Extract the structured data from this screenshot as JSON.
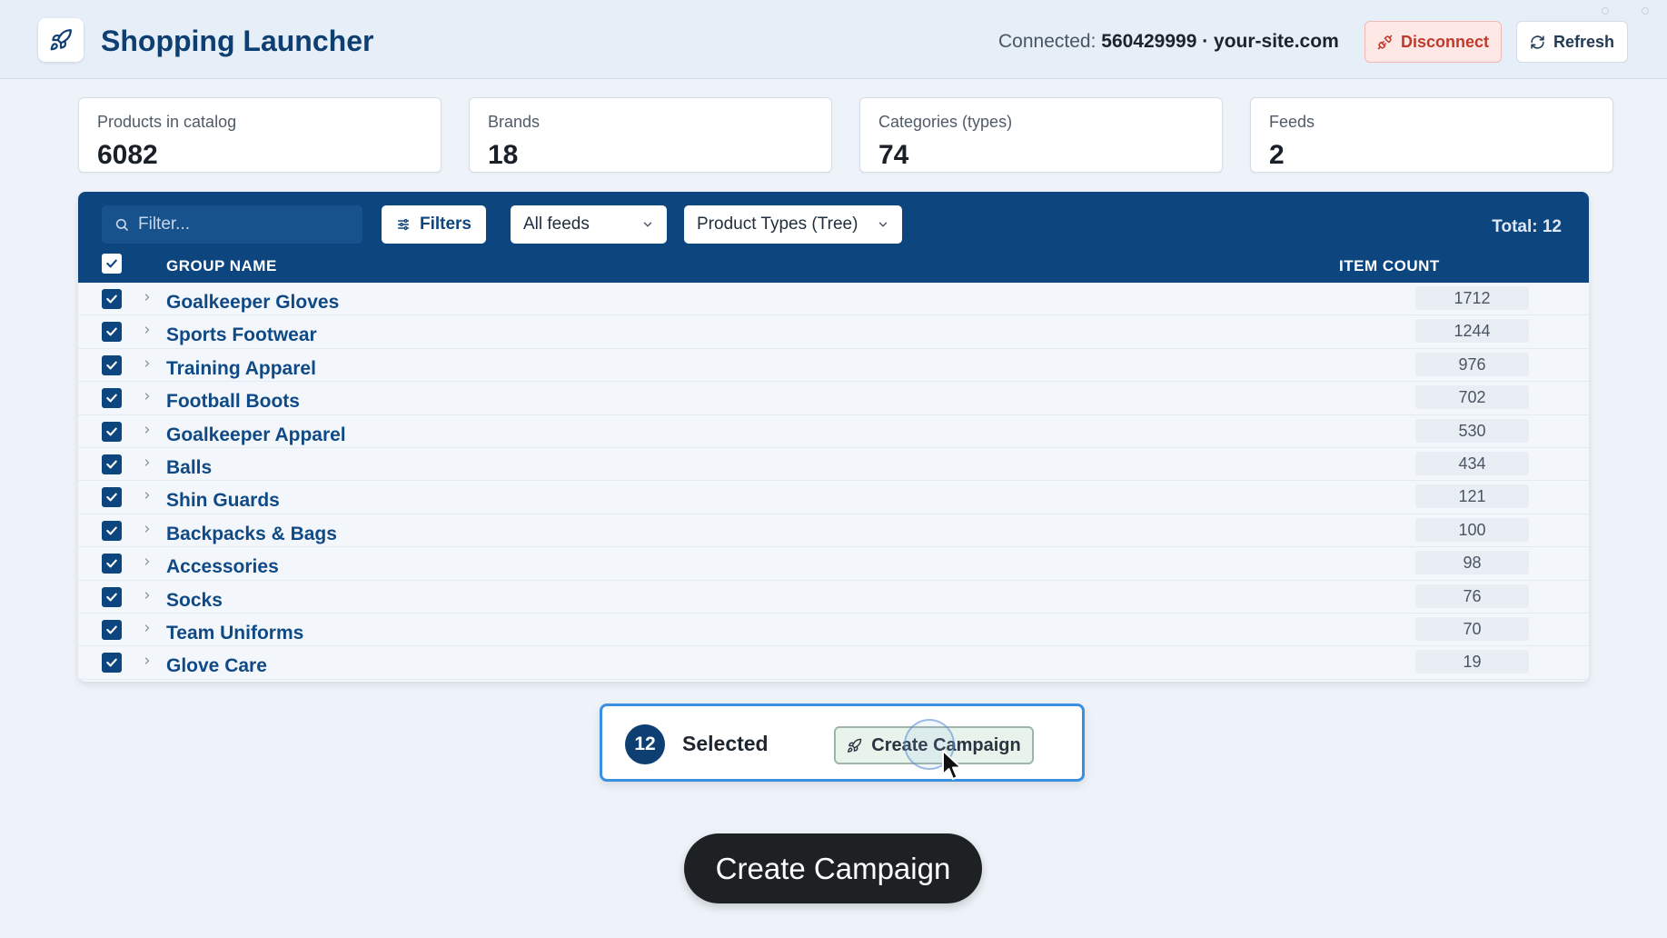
{
  "header": {
    "title": "Shopping Launcher",
    "connected_prefix": "Connected:",
    "connected_value": "560429999 · your-site.com",
    "disconnect_label": "Disconnect",
    "refresh_label": "Refresh"
  },
  "stats": [
    {
      "label": "Products in catalog",
      "value": "6082"
    },
    {
      "label": "Brands",
      "value": "18"
    },
    {
      "label": "Categories (types)",
      "value": "74"
    },
    {
      "label": "Feeds",
      "value": "2"
    }
  ],
  "toolbar": {
    "filter_placeholder": "Filter...",
    "filters_label": "Filters",
    "feeds_selected": "All feeds",
    "types_selected": "Product Types (Tree)",
    "total": "Total: 12"
  },
  "table": {
    "col_group": "GROUP NAME",
    "col_count": "ITEM COUNT",
    "rows": [
      {
        "name": "Goalkeeper Gloves",
        "count": "1712"
      },
      {
        "name": "Sports Footwear",
        "count": "1244"
      },
      {
        "name": "Training Apparel",
        "count": "976"
      },
      {
        "name": "Football Boots",
        "count": "702"
      },
      {
        "name": "Goalkeeper Apparel",
        "count": "530"
      },
      {
        "name": "Balls",
        "count": "434"
      },
      {
        "name": "Shin Guards",
        "count": "121"
      },
      {
        "name": "Backpacks & Bags",
        "count": "100"
      },
      {
        "name": "Accessories",
        "count": "98"
      },
      {
        "name": "Socks",
        "count": "76"
      },
      {
        "name": "Team Uniforms",
        "count": "70"
      },
      {
        "name": "Glove Care",
        "count": "19"
      }
    ]
  },
  "selection": {
    "count": "12",
    "label": "Selected",
    "create_label": "Create Campaign"
  },
  "cta": {
    "label": "Create Campaign"
  },
  "colors": {
    "brand": "#0e3f73",
    "toolbar": "#0d467f",
    "danger": "#c0392b",
    "highlight": "#3b8fe0"
  }
}
